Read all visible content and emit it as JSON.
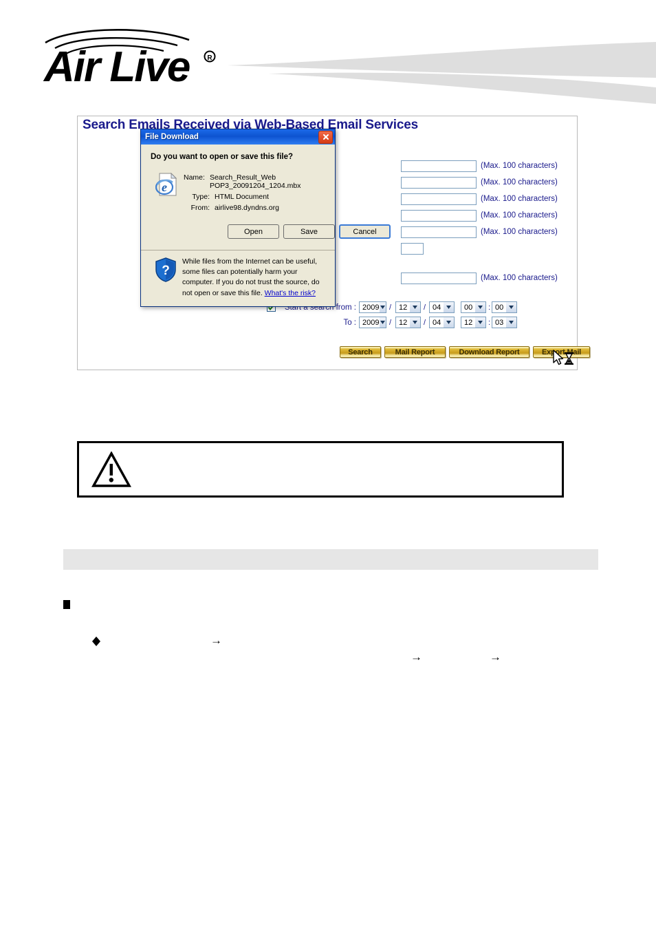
{
  "header": {
    "logo_text": "Air Live",
    "logo_registered": "®",
    "logo_alt": "AirLive"
  },
  "panel": {
    "title": "Search Emails Received via Web-Based Email Services",
    "max_chars_hint": "(Max. 100 characters)",
    "fields": [
      {
        "value": "",
        "hint": "(Max. 100 characters)"
      },
      {
        "value": "",
        "hint": "(Max. 100 characters)"
      },
      {
        "value": "",
        "hint": "(Max. 100 characters)"
      },
      {
        "value": "",
        "hint": "(Max. 100 characters)"
      },
      {
        "value": "",
        "hint": "(Max. 100 characters)"
      },
      {
        "value": "",
        "hint": ""
      },
      {
        "value": "",
        "hint": "(Max. 100 characters)"
      }
    ],
    "date_range": {
      "enabled": true,
      "from_label": "Start a search from :",
      "to_label": "To :",
      "separator_date": "/",
      "separator_time": ":",
      "from": {
        "year": "2009",
        "month": "12",
        "day": "04",
        "hour": "00",
        "minute": "00"
      },
      "to": {
        "year": "2009",
        "month": "12",
        "day": "04",
        "hour": "12",
        "minute": "03"
      }
    },
    "buttons": [
      {
        "label": "Search"
      },
      {
        "label": "Mail Report"
      },
      {
        "label": "Download Report"
      },
      {
        "label": "Export Mail"
      }
    ],
    "cursor_state": "busy"
  },
  "dialog": {
    "title": "File Download",
    "close_label": "x",
    "question": "Do you want to open or save this file?",
    "file_icon": "internet-explorer-document-icon",
    "rows": [
      {
        "label": "Name:",
        "value": "Search_Result_Web POP3_20091204_1204.mbx"
      },
      {
        "label": "Type:",
        "value": "HTML Document"
      },
      {
        "label": "From:",
        "value": "airlive98.dyndns.org"
      }
    ],
    "buttons": [
      {
        "label": "Open",
        "focused": false
      },
      {
        "label": "Save",
        "focused": false
      },
      {
        "label": "Cancel",
        "focused": true
      }
    ],
    "warning": {
      "icon": "shield-question-icon",
      "text": "While files from the Internet can be useful, some files can potentially harm your computer. If you do not trust the source, do not open or save this file. ",
      "link_text": "What's the risk?"
    }
  },
  "note": {
    "icon": "warning-triangle-icon",
    "text": ""
  },
  "section_bar": {
    "text": ""
  },
  "bullets": {
    "square_text": "",
    "diamond_text": "",
    "arrow_glyph": "→"
  },
  "colors": {
    "title_blue": "#1a1a8c",
    "dialog_titlebar": "#0a58d6",
    "dialog_face": "#ece9d8",
    "gold": "#cfa424",
    "link_blue": "#0000cc",
    "graybar": "#e6e6e6"
  }
}
